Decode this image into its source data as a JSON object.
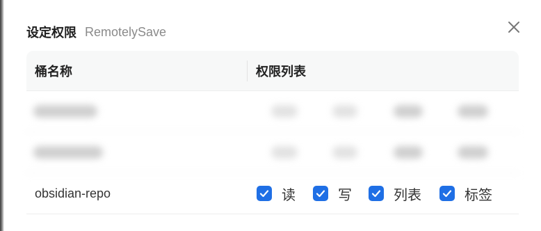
{
  "dialog": {
    "title": "设定权限",
    "subtitle": "RemotelySave"
  },
  "table": {
    "columns": [
      "桶名称",
      "权限列表"
    ],
    "rows": [
      {
        "bucket": "obsidian-repo",
        "permissions": [
          {
            "label": "读",
            "checked": true
          },
          {
            "label": "写",
            "checked": true
          },
          {
            "label": "列表",
            "checked": true
          },
          {
            "label": "标签",
            "checked": true
          }
        ]
      }
    ]
  },
  "colors": {
    "checkbox": "#1f6fe5",
    "header_bg": "#f7f8f8",
    "subtitle": "#8a8a8a"
  },
  "icons": {
    "close": "close-icon",
    "check": "checkmark-icon"
  }
}
